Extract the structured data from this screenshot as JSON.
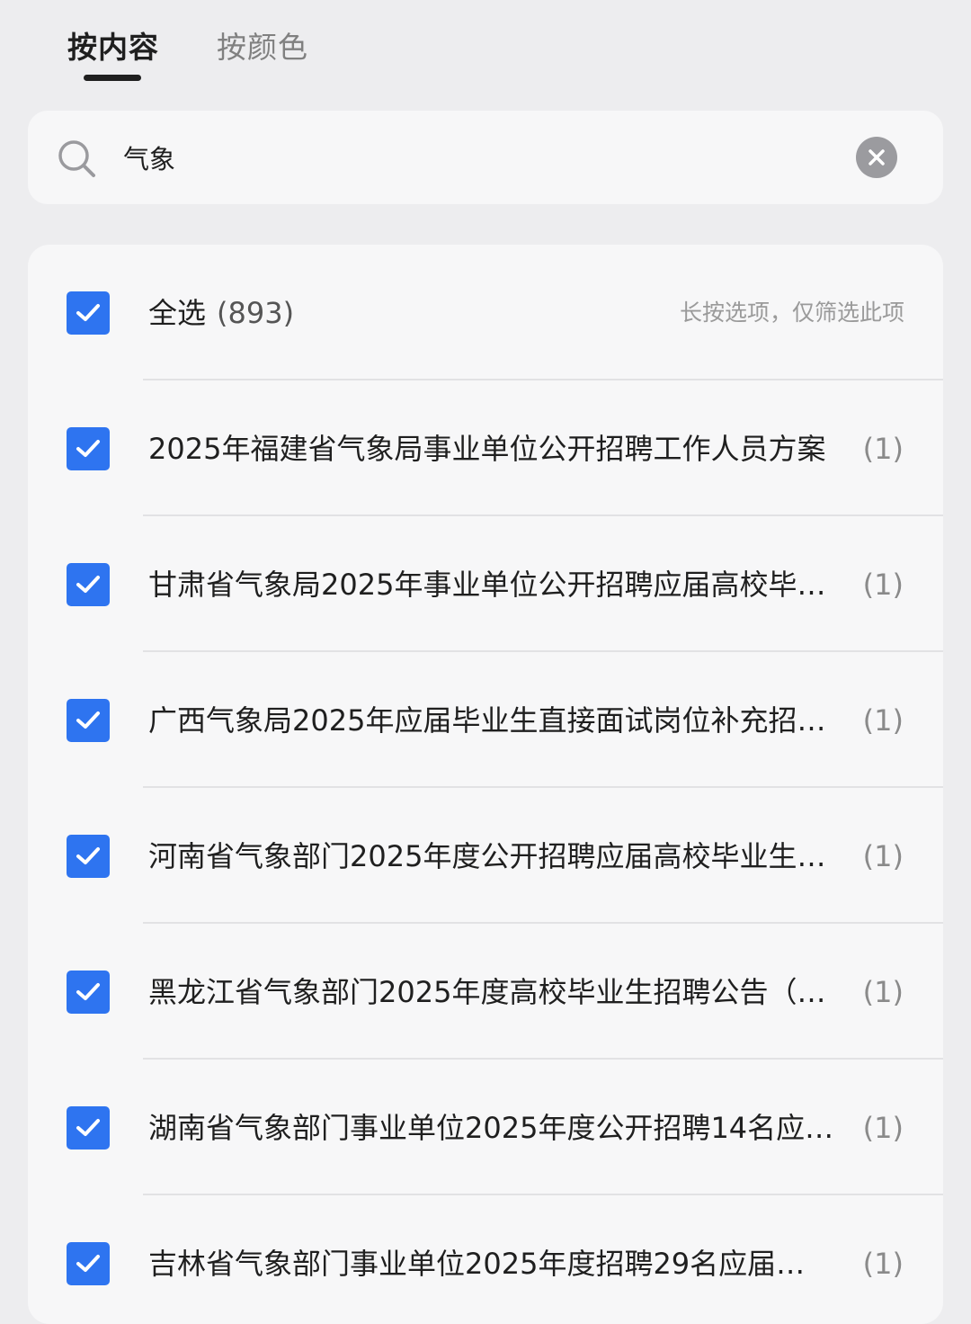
{
  "tabs": [
    {
      "label": "按内容",
      "active": true
    },
    {
      "label": "按颜色",
      "active": false
    }
  ],
  "search": {
    "value": "气象"
  },
  "select_all": {
    "label": "全选",
    "count": "(893)",
    "hint": "长按选项，仅筛选此项",
    "checked": true
  },
  "items": [
    {
      "label": "2025年福建省气象局事业单位公开招聘工作人员方案",
      "count": "(1)",
      "checked": true
    },
    {
      "label": "甘肃省气象局2025年事业单位公开招聘应届高校毕…",
      "count": "(1)",
      "checked": true
    },
    {
      "label": "广西气象局2025年应届毕业生直接面试岗位补充招…",
      "count": "(1)",
      "checked": true
    },
    {
      "label": "河南省气象部门2025年度公开招聘应届高校毕业生…",
      "count": "(1)",
      "checked": true
    },
    {
      "label": "黑龙江省气象部门2025年度高校毕业生招聘公告（…",
      "count": "(1)",
      "checked": true
    },
    {
      "label": "湖南省气象部门事业单位2025年度公开招聘14名应…",
      "count": "(1)",
      "checked": true
    },
    {
      "label": "吉林省气象部门事业单位2025年度招聘29名应届…",
      "count": "(1)",
      "checked": true
    }
  ],
  "colors": {
    "accent": "#2e74f0",
    "background": "#ededef",
    "card": "#f7f7f8"
  }
}
